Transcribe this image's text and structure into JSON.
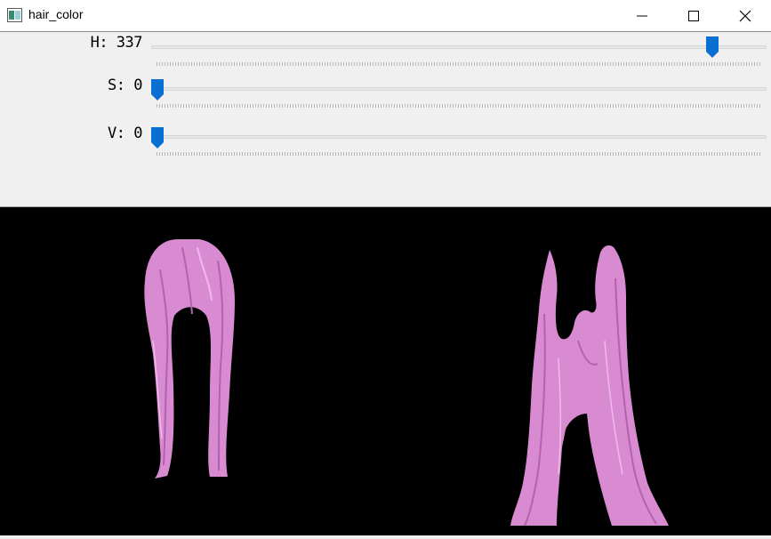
{
  "window": {
    "title": "hair_color",
    "icons": [
      "app-icon",
      "minimize-icon",
      "maximize-icon",
      "close-icon"
    ]
  },
  "trackbars": [
    {
      "name": "H",
      "label": "H: 337",
      "value": 337,
      "fraction": 0.92
    },
    {
      "name": "S",
      "label": "S: 0",
      "value": 0,
      "fraction": 0.0
    },
    {
      "name": "V",
      "label": "V: 0",
      "value": 0,
      "fraction": 0.0
    }
  ],
  "colors": {
    "thumb": "#0a6fd3",
    "hair": "#d98bd2",
    "hair_shadow": "#b262ae",
    "canvas_background": "#000000"
  }
}
